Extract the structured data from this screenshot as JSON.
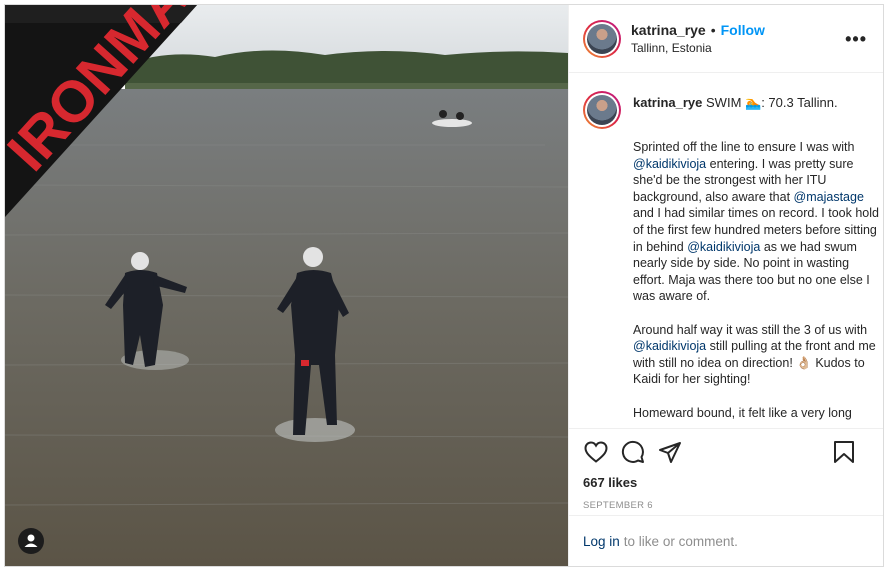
{
  "header": {
    "username": "katrina_rye",
    "dot": "•",
    "follow_label": "Follow",
    "location": "Tallinn, Estonia",
    "more_label": "•••"
  },
  "banner": {
    "brand_text": "IRONMAN"
  },
  "caption": {
    "username": "katrina_rye",
    "title": "SWIM 🏊: 70.3 Tallinn.",
    "paragraphs": [
      [
        {
          "t": "Sprinted off the line to ensure I was with ",
          "m": false
        },
        {
          "t": "@kaidikivioja",
          "m": true
        },
        {
          "t": " entering. I was pretty sure she'd be the strongest with her ITU background, also aware that ",
          "m": false
        },
        {
          "t": "@majastage",
          "m": true
        },
        {
          "t": " and I had similar times on record. I took hold of the first few hundred meters before sitting in behind ",
          "m": false
        },
        {
          "t": "@kaidikivioja",
          "m": true
        },
        {
          "t": " as we had swum nearly side by side. No point in wasting effort. Maja was there too but no one else I was aware of.",
          "m": false
        }
      ],
      [
        {
          "t": "Around half way it was still the 3 of us with ",
          "m": false
        },
        {
          "t": "@kaidikivioja",
          "m": true
        },
        {
          "t": " still pulling at the front and me with still no idea on direction! 👌🏼 Kudos to Kaidi for her sighting!",
          "m": false
        }
      ],
      [
        {
          "t": "Homeward bound, it felt like a very long",
          "m": false
        }
      ]
    ]
  },
  "actions": {
    "likes": "667 likes",
    "date": "SEPTEMBER 6"
  },
  "login": {
    "link": "Log in",
    "text": "to like or comment."
  },
  "icons": [
    "heart-icon",
    "comment-icon",
    "share-icon",
    "bookmark-icon",
    "user-tag-icon"
  ],
  "colors": {
    "follow": "#0095f6",
    "mention": "#00376b",
    "muted": "#8e8e8e",
    "banner_red": "#d7282f"
  }
}
